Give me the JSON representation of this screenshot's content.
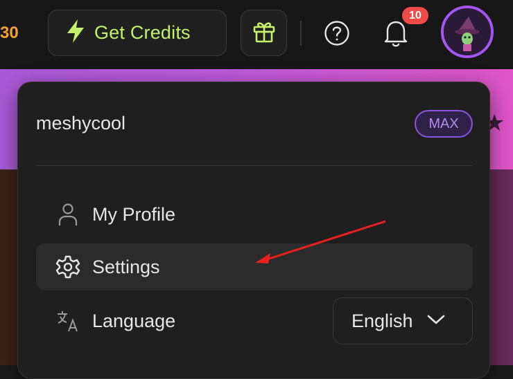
{
  "header": {
    "credits_count": "30",
    "get_credits_label": "Get Credits",
    "notification_count": "10",
    "icons": {
      "lightning": "lightning-icon",
      "gift": "gift-icon",
      "help": "help-circle-icon",
      "bell": "bell-icon"
    }
  },
  "menu": {
    "username": "meshycool",
    "plan": "MAX",
    "items": [
      {
        "label": "My Profile",
        "icon": "user-icon"
      },
      {
        "label": "Settings",
        "icon": "gear-icon"
      },
      {
        "label": "Language",
        "icon": "translate-icon"
      }
    ],
    "language_value": "English"
  },
  "colors": {
    "accent_green": "#c5f26a",
    "accent_purple": "#a357f0",
    "badge_red": "#ef4b4b",
    "credits_orange": "#f0a334"
  }
}
